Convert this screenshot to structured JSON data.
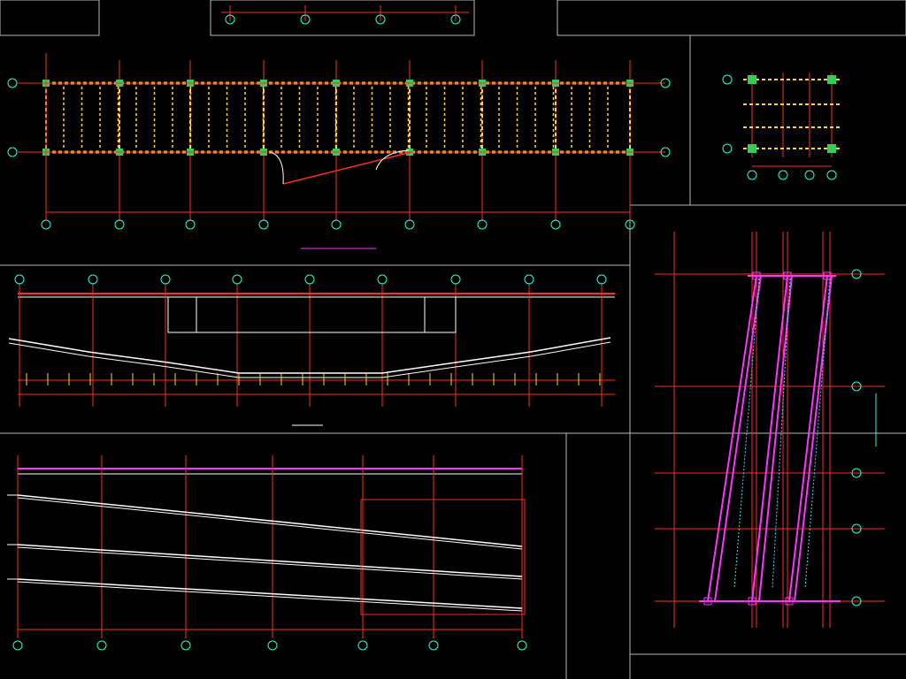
{
  "colors": {
    "background": "#000000",
    "frame": "#b8b8b8",
    "axis": "#ff2a2a",
    "beam": "#ffd23a",
    "column": "#2fcf5a",
    "bubble": "#22ffd9",
    "slab": "#ffffff",
    "rebar": "#ff33ff",
    "hidden": "#36e0ff"
  },
  "watermark": {
    "label": ""
  }
}
